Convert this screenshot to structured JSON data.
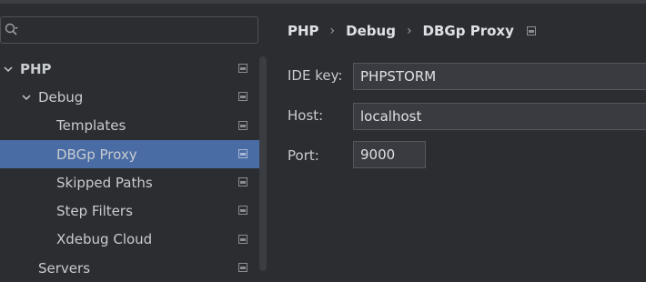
{
  "search": {
    "value": "",
    "placeholder": ""
  },
  "tree": [
    {
      "label": "PHP",
      "expanded": true,
      "bold": true,
      "selected": false
    },
    {
      "label": "Debug",
      "expanded": true,
      "bold": false,
      "selected": false
    },
    {
      "label": "Templates",
      "bold": false,
      "selected": false
    },
    {
      "label": "DBGp Proxy",
      "bold": false,
      "selected": true
    },
    {
      "label": "Skipped Paths",
      "bold": false,
      "selected": false
    },
    {
      "label": "Step Filters",
      "bold": false,
      "selected": false
    },
    {
      "label": "Xdebug Cloud",
      "bold": false,
      "selected": false
    },
    {
      "label": "Servers",
      "bold": false,
      "selected": false
    }
  ],
  "breadcrumb": {
    "items": [
      "PHP",
      "Debug",
      "DBGp Proxy"
    ],
    "separator": "›"
  },
  "form": {
    "ide_key": {
      "label": "IDE key:",
      "value": "PHPSTORM"
    },
    "host": {
      "label": "Host:",
      "value": "localhost"
    },
    "port": {
      "label": "Port:",
      "value": "9000"
    }
  },
  "colors": {
    "selection": "#4a6ca4",
    "background": "#2b2d30",
    "field_bg": "#393b40"
  },
  "icons": {
    "search": "search-icon",
    "chevron": "chevron-down-icon",
    "project": "project-level-icon"
  }
}
